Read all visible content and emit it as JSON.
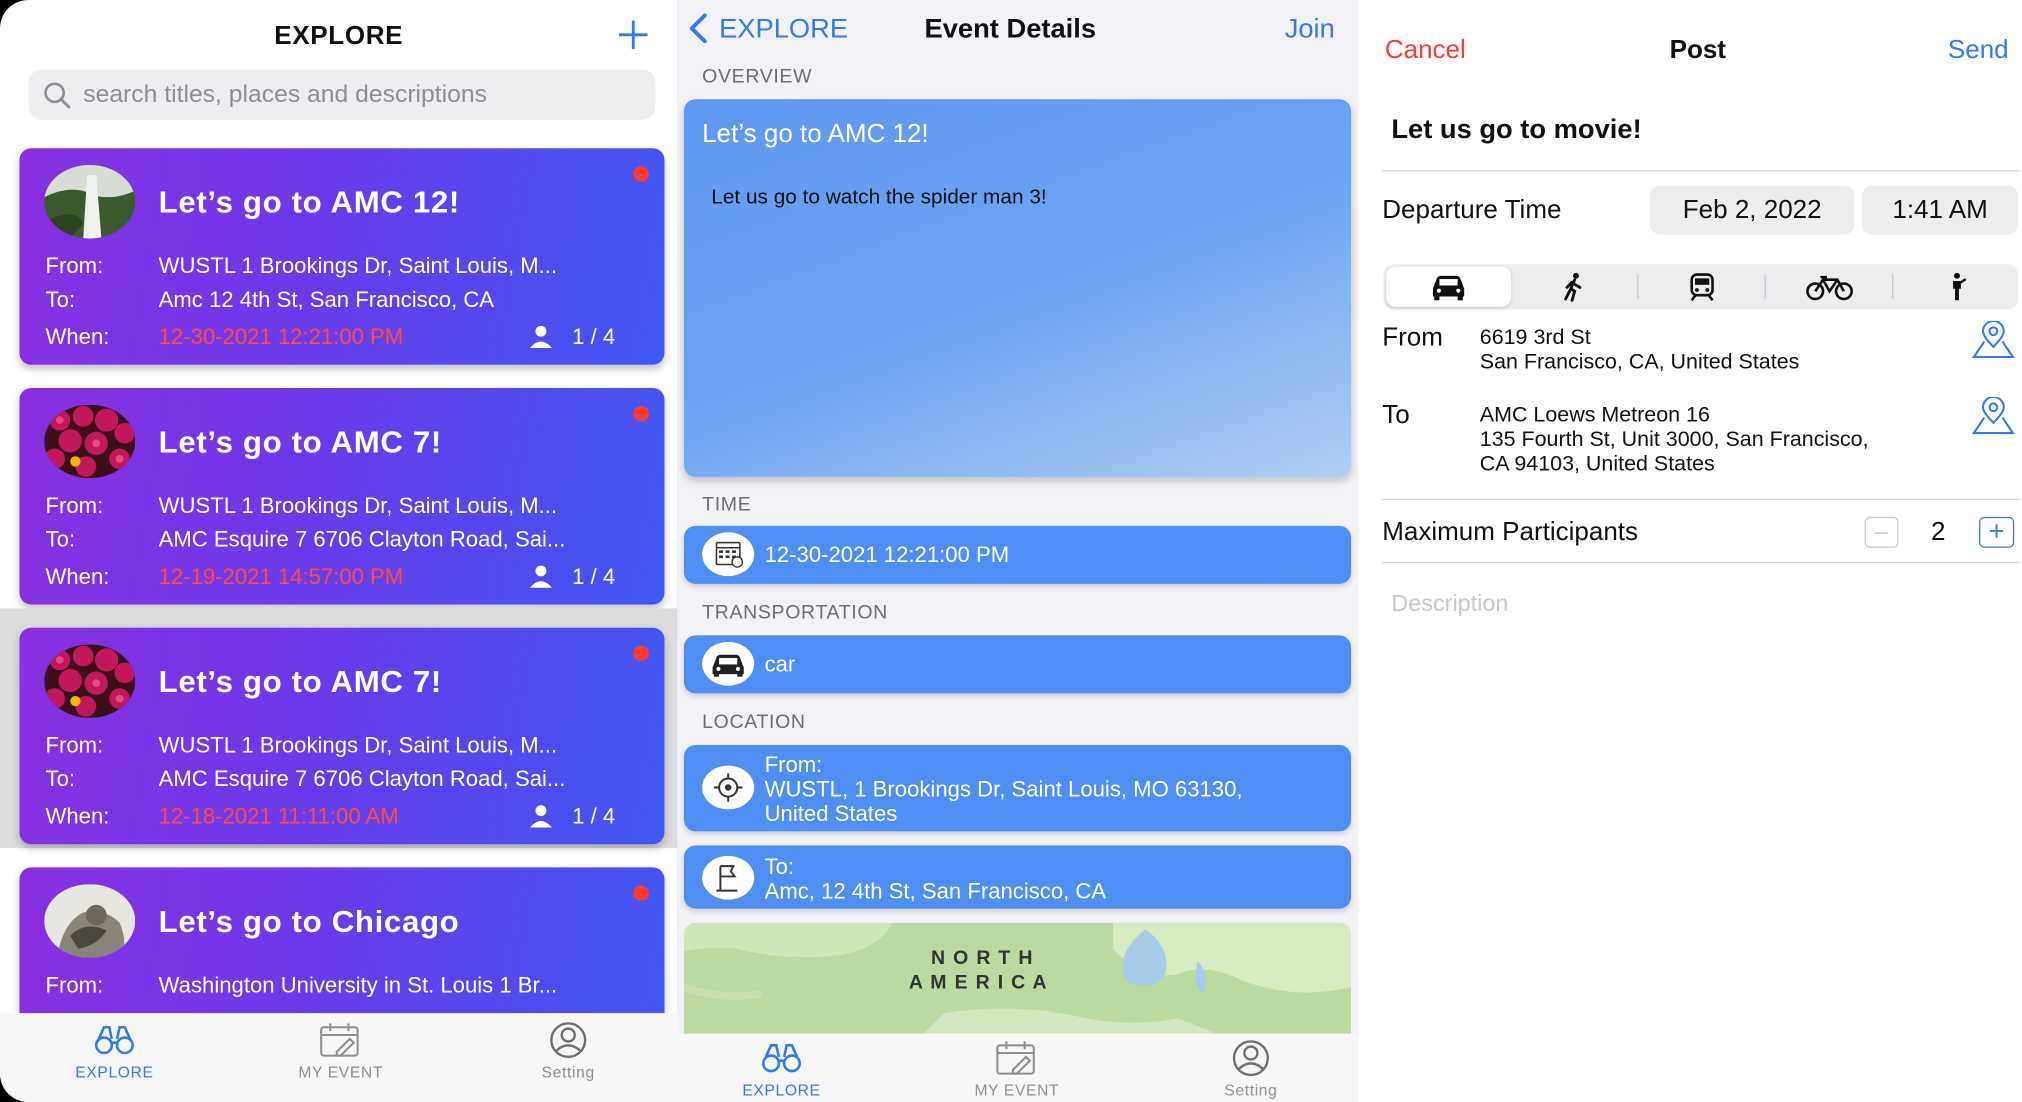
{
  "explore": {
    "title": "EXPLORE",
    "search_placeholder": "search titles, places and descriptions",
    "labels": {
      "from": "From:",
      "to": "To:",
      "when": "When:"
    },
    "events": [
      {
        "title": "Let’s go to AMC 12!",
        "from": "WUSTL 1 Brookings Dr, Saint Louis, M...",
        "to": "Amc 12 4th St, San Francisco, CA",
        "when": "12-30-2021 12:21:00 PM",
        "participants": "1 / 4",
        "image": "waterfall"
      },
      {
        "title": "Let’s go to AMC 7!",
        "from": "WUSTL 1 Brookings Dr, Saint Louis, M...",
        "to": "AMC Esquire 7 6706 Clayton Road, Sai...",
        "when": "12-19-2021 14:57:00 PM",
        "participants": "1 / 4",
        "image": "flowers"
      },
      {
        "title": "Let’s go to AMC 7!",
        "from": "WUSTL 1 Brookings Dr, Saint Louis, M...",
        "to": "AMC Esquire 7 6706 Clayton Road, Sai...",
        "when": "12-18-2021 11:11:00 AM",
        "participants": "1 / 4",
        "image": "flowers"
      },
      {
        "title": "Let’s go to Chicago",
        "from": "Washington University in St. Louis 1 Br...",
        "image": "gorilla"
      }
    ]
  },
  "tabs": [
    {
      "label": "EXPLORE",
      "icon": "binoculars-icon"
    },
    {
      "label": "MY EVENT",
      "icon": "calendar-edit-icon"
    },
    {
      "label": "Setting",
      "icon": "user-circle-icon"
    }
  ],
  "details": {
    "back_label": "EXPLORE",
    "title": "Event Details",
    "join_label": "Join",
    "sections": {
      "overview": "OVERVIEW",
      "time": "TIME",
      "transportation": "TRANSPORTATION",
      "location": "LOCATION"
    },
    "overview_title": "Let’s go to AMC 12!",
    "overview_desc": "Let us go to watch the  spider man 3!",
    "time": "12-30-2021 12:21:00 PM",
    "transportation": "car",
    "from_label": "From:",
    "from_line1": "WUSTL, 1 Brookings Dr, Saint Louis, MO  63130,",
    "from_line2": "United States",
    "to_label": "To:",
    "to_value": "Amc, 12 4th St, San Francisco, CA",
    "map_label_1": "N O R T H",
    "map_label_2": "A M E R I C A"
  },
  "post": {
    "cancel": "Cancel",
    "title": "Post",
    "send": "Send",
    "event_title": "Let us go to movie!",
    "departure_label": "Departure Time",
    "date": "Feb 2, 2022",
    "time": "1:41 AM",
    "transport_modes": [
      "car-icon",
      "walk-icon",
      "train-icon",
      "bicycle-icon",
      "stand-icon"
    ],
    "selected_mode": "car",
    "from_label": "From",
    "from_line1": "6619 3rd St",
    "from_line2": "San Francisco, CA, United States",
    "to_label": "To",
    "to_line1": "AMC Loews Metreon 16",
    "to_line2": "135 Fourth St, Unit 3000, San Francisco,",
    "to_line3": "CA 94103, United States",
    "max_label": "Maximum Participants",
    "max_value": "2",
    "description_placeholder": "Description"
  },
  "colors": {
    "accent": "#2f7bf0",
    "cancel": "#ff3b30",
    "card_start": "#8a2fe0",
    "card_end": "#3f57f2",
    "pill": "#4f8ef2",
    "date_text": "#ff4a3d"
  }
}
